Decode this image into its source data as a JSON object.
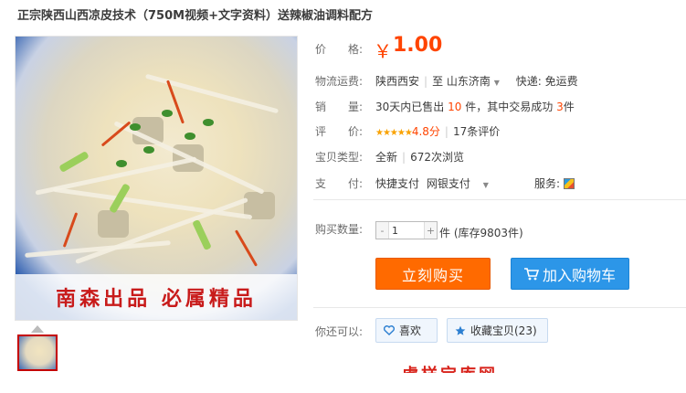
{
  "title": "正宗陕西山西凉皮技术（750M视频+文字资料）送辣椒油调料配方",
  "image": {
    "banner_text": "南森出品 必属精品"
  },
  "price": {
    "label": "价　　格:",
    "currency": "￥",
    "value": "1.00"
  },
  "shipping": {
    "label": "物流运费:",
    "from": "陕西西安",
    "to_prefix": "至",
    "to": "山东济南",
    "method": "快递: 免运费"
  },
  "sales": {
    "label": "销　　量:",
    "prefix": "30天内已售出",
    "count": "10",
    "mid": "件，其中交易成功",
    "success": "3",
    "suffix": "件"
  },
  "rating": {
    "label": "评　　价:",
    "stars": "★★★★★",
    "score": "4.8分",
    "reviews": "17条评价"
  },
  "type": {
    "label": "宝贝类型:",
    "condition": "全新",
    "views": "672次浏览"
  },
  "payment": {
    "label": "支　　付:",
    "method1": "快捷支付",
    "method2": "网银支付",
    "service_label": "服务:"
  },
  "quantity": {
    "label": "购买数量:",
    "value": "1",
    "minus": "-",
    "plus": "+",
    "stock_text": "件 (库存9803件)"
  },
  "buttons": {
    "buy_now": "立刻购买",
    "add_to_cart": "加入购物车"
  },
  "also": {
    "label": "你还可以:",
    "like": "喜欢",
    "favorite": "收藏宝贝(23)"
  },
  "footer_partial": {
    "text": "虎样宝库网",
    "dots": "…"
  },
  "colors": {
    "price": "#ff4400",
    "buy_button": "#ff6a00",
    "cart_button": "#2c96e8",
    "accent_red": "#c40000"
  },
  "icons": [
    "dropdown-caret-icon",
    "service-icon",
    "cart-icon",
    "heart-icon",
    "star-icon"
  ]
}
